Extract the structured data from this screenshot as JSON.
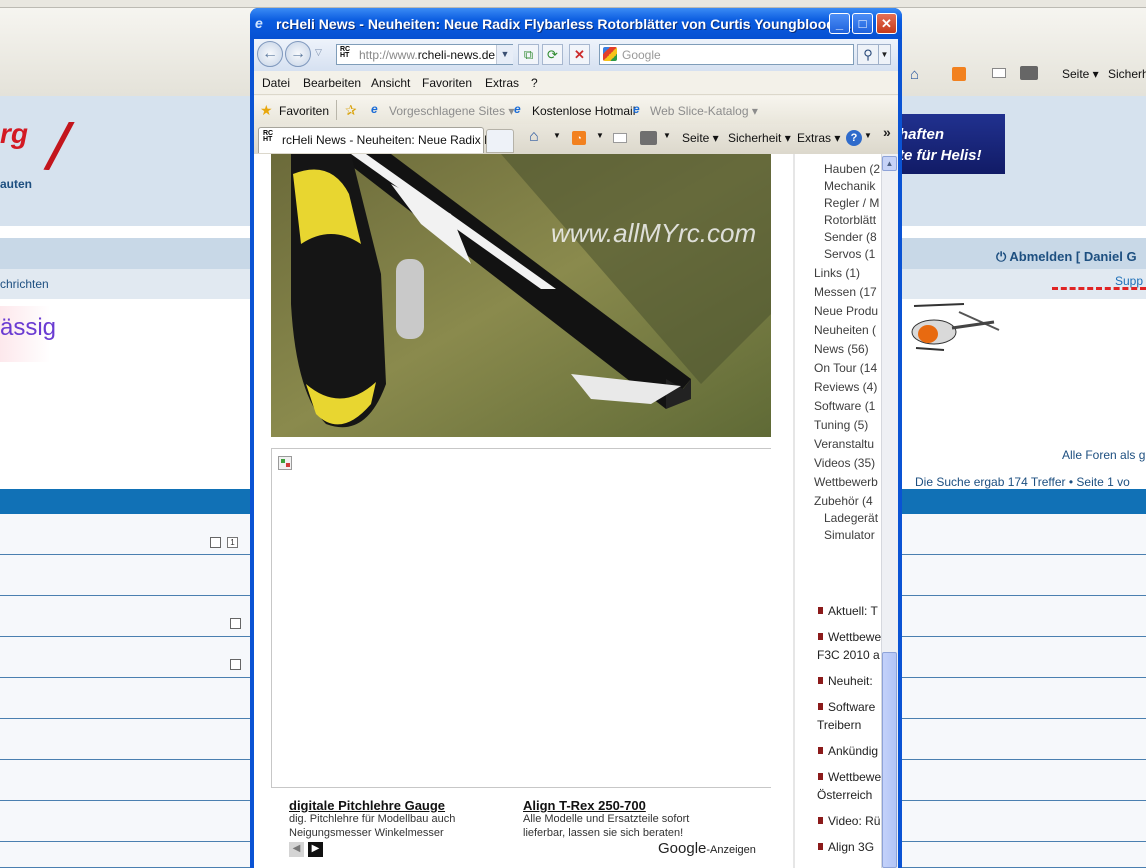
{
  "background_page": {
    "toolbar": {
      "seite": "Seite ▾",
      "sicherheit": "Sicherhe"
    },
    "logo_text": "rg",
    "logo_sub": "auten",
    "ad_banner": {
      "line1": "haften",
      "line2": "te für Helis!"
    },
    "logout": "Abmelden [ Daniel G",
    "nav_text": "chrichten",
    "support_link": "Supp",
    "big_text": "ässig",
    "forum_link": "Alle Foren als g",
    "search_result": "Die Suche ergab 174 Treffer • Seite 1 vo",
    "page_badge": "1"
  },
  "window": {
    "title": "rcHeli News - Neuheiten: Neue Radix Flybarless Rotorblätter von Curtis Youngblood - ...",
    "address": {
      "prefix": "http://www.",
      "host": "rcheli-news.de"
    },
    "search_placeholder": "Google",
    "menu": [
      "Datei",
      "Bearbeiten",
      "Ansicht",
      "Favoriten",
      "Extras",
      "?"
    ],
    "favorites": {
      "favoriten": "Favoriten",
      "suggested": "Vorgeschlagene Sites ▾",
      "hotmail": "Kostenlose Hotmail",
      "webslice": "Web Slice-Katalog ▾"
    },
    "tab_title": "rcHeli News - Neuheiten: Neue Radix F...",
    "tools": {
      "seite": "Seite ▾",
      "sicherheit": "Sicherheit ▾",
      "extras": "Extras ▾"
    },
    "chevron": "»"
  },
  "article": {
    "watermark": "www.allMYrc.com",
    "ads": [
      {
        "title": "digitale Pitchlehre Gauge",
        "line1": "dig. Pitchlehre für Modellbau auch",
        "line2": "Neigungsmesser Winkelmesser"
      },
      {
        "title": "Align T-Rex 250-700",
        "line1": "Alle Modelle und Ersatzteile sofort",
        "line2": "lieferbar, lassen sie sich beraten!"
      }
    ],
    "google_ads": {
      "brand": "Google",
      "suffix": "-Anzeigen"
    }
  },
  "sidebar": {
    "categories": [
      "Hauben (2",
      "Mechanik",
      "Regler / M",
      "Rotorblätt",
      "Sender (8",
      "Servos (1",
      "Links (1)",
      "Messen (17",
      "Neue Produ",
      "Neuheiten (",
      "News (56)",
      "On Tour (14",
      "Reviews (4)",
      "Software (1",
      "Tuning (5)",
      "Veranstaltu",
      "Videos (35)",
      "Wettbewerb",
      "Zubehör (4",
      "Ladegerät",
      "Simulator"
    ],
    "news": [
      "Aktuell: T",
      "Wettbewe",
      "F3C 2010 a",
      "Neuheit:",
      "Software",
      "Treibern",
      "Ankündig",
      "Wettbewe",
      "Österreich",
      "Video: Rü",
      "Align 3G"
    ]
  },
  "colors": {
    "title_blue": "#0a5ce0",
    "forum_blue": "#1171b6",
    "ad_red": "#d31a23"
  }
}
